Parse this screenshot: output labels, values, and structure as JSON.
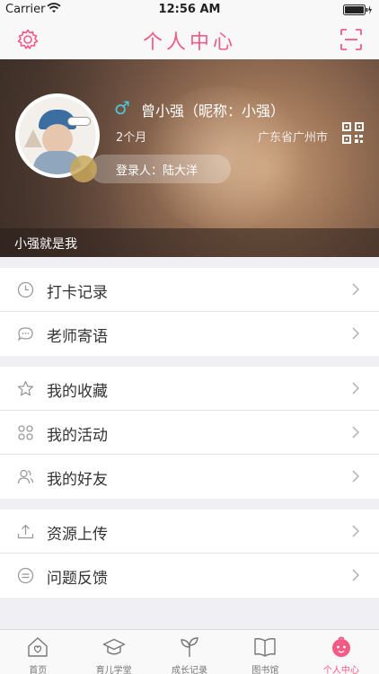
{
  "status_bar": {
    "carrier": "Carrier",
    "time": "12:56 AM"
  },
  "nav": {
    "title": "个人中心",
    "settings_icon": "gear-icon",
    "scan_icon": "scan-icon"
  },
  "colors": {
    "accent": "#f25b86",
    "gender": "#4fc7d6"
  },
  "profile": {
    "gender_symbol": "♂",
    "name": "曾小强（昵称：小强）",
    "age": "2个月",
    "location": "广东省广州市",
    "login_user": "登录人：陆大洋",
    "motto": "小强就是我"
  },
  "menu_groups": [
    [
      {
        "label": "打卡记录",
        "icon": "clock-icon"
      },
      {
        "label": "老师寄语",
        "icon": "chat-bubble-icon"
      }
    ],
    [
      {
        "label": "我的收藏",
        "icon": "star-icon"
      },
      {
        "label": "我的活动",
        "icon": "activity-grid-icon"
      },
      {
        "label": "我的好友",
        "icon": "friends-icon"
      }
    ],
    [
      {
        "label": "资源上传",
        "icon": "upload-icon"
      },
      {
        "label": "问题反馈",
        "icon": "feedback-icon"
      }
    ]
  ],
  "tabs": [
    {
      "label": "首页",
      "icon": "home-icon"
    },
    {
      "label": "育儿学堂",
      "icon": "graduation-cap-icon"
    },
    {
      "label": "成长记录",
      "icon": "sprout-icon"
    },
    {
      "label": "图书馆",
      "icon": "book-icon"
    },
    {
      "label": "个人中心",
      "icon": "baby-face-icon",
      "active": true
    }
  ]
}
